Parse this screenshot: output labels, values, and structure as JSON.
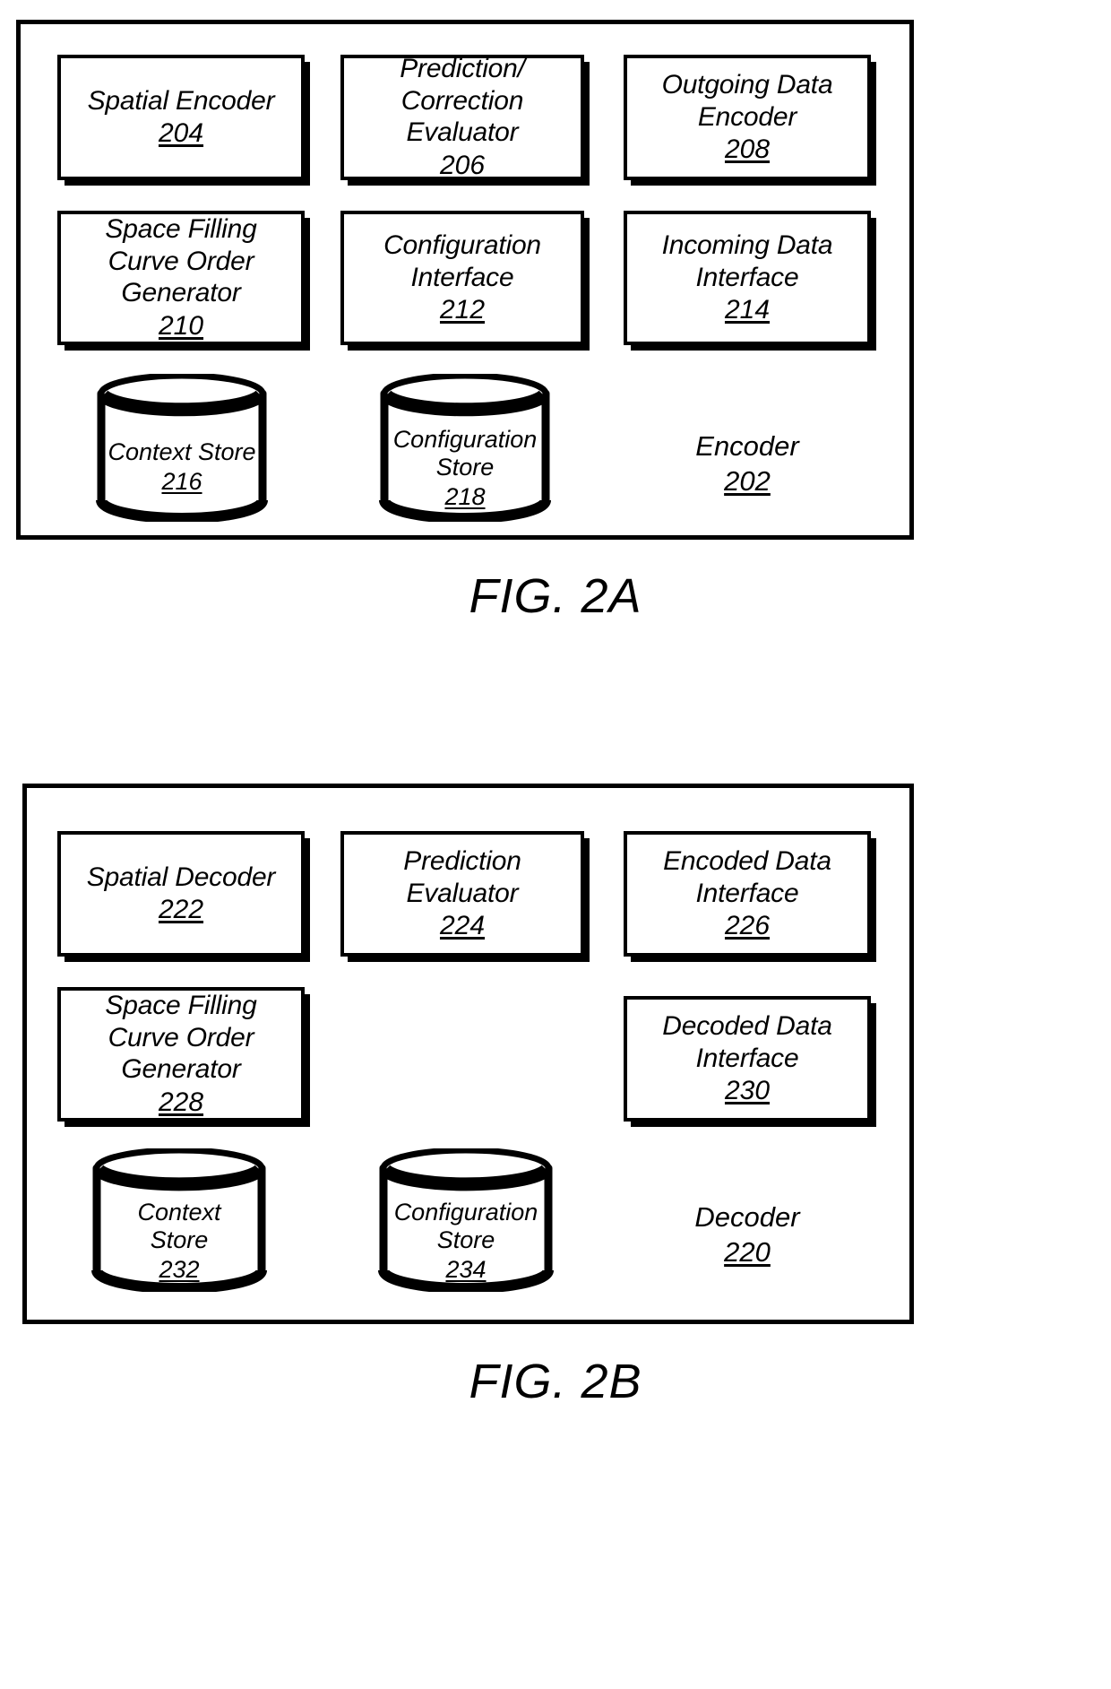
{
  "figures": [
    {
      "id": "fig-2a",
      "caption": "FIG. 2A",
      "frame_title": {
        "label": "Encoder",
        "ref": "202"
      },
      "boxes": [
        {
          "label": "Spatial Encoder",
          "ref": "204"
        },
        {
          "label": "Prediction/\nCorrection\nEvaluator",
          "ref": "206"
        },
        {
          "label": "Outgoing Data\nEncoder",
          "ref": "208"
        },
        {
          "label": "Space Filling\nCurve Order\nGenerator",
          "ref": "210"
        },
        {
          "label": "Configuration\nInterface",
          "ref": "212"
        },
        {
          "label": "Incoming Data\nInterface",
          "ref": "214"
        }
      ],
      "stores": [
        {
          "label": "Context Store",
          "ref": "216"
        },
        {
          "label": "Configuration\nStore",
          "ref": "218"
        }
      ]
    },
    {
      "id": "fig-2b",
      "caption": "FIG. 2B",
      "frame_title": {
        "label": "Decoder",
        "ref": "220"
      },
      "boxes": [
        {
          "label": "Spatial Decoder",
          "ref": "222"
        },
        {
          "label": "Prediction\nEvaluator",
          "ref": "224"
        },
        {
          "label": "Encoded Data\nInterface",
          "ref": "226"
        },
        {
          "label": "Space Filling\nCurve Order\nGenerator",
          "ref": "228"
        },
        {
          "label": "Decoded Data\nInterface",
          "ref": "230"
        }
      ],
      "stores": [
        {
          "label": "Context\nStore",
          "ref": "232"
        },
        {
          "label": "Configuration\nStore",
          "ref": "234"
        }
      ]
    }
  ],
  "colors": {
    "ink": "#000000",
    "paper": "#ffffff"
  }
}
